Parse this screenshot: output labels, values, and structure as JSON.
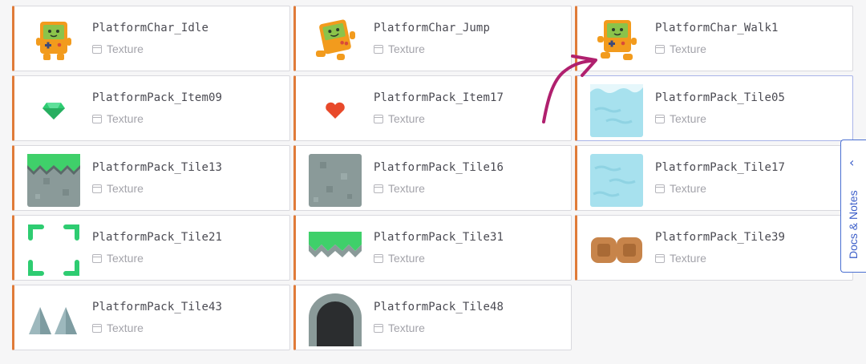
{
  "assets": [
    {
      "name": "PlatformChar_Idle",
      "type": "Texture",
      "thumb": "char-idle"
    },
    {
      "name": "PlatformChar_Jump",
      "type": "Texture",
      "thumb": "char-jump"
    },
    {
      "name": "PlatformChar_Walk1",
      "type": "Texture",
      "thumb": "char-walk"
    },
    {
      "name": "PlatformPack_Item09",
      "type": "Texture",
      "thumb": "gem"
    },
    {
      "name": "PlatformPack_Item17",
      "type": "Texture",
      "thumb": "heart"
    },
    {
      "name": "PlatformPack_Tile05",
      "type": "Texture",
      "thumb": "water-top"
    },
    {
      "name": "PlatformPack_Tile13",
      "type": "Texture",
      "thumb": "grass-stone"
    },
    {
      "name": "PlatformPack_Tile16",
      "type": "Texture",
      "thumb": "stone"
    },
    {
      "name": "PlatformPack_Tile17",
      "type": "Texture",
      "thumb": "water"
    },
    {
      "name": "PlatformPack_Tile21",
      "type": "Texture",
      "thumb": "frame"
    },
    {
      "name": "PlatformPack_Tile31",
      "type": "Texture",
      "thumb": "grass-spikes"
    },
    {
      "name": "PlatformPack_Tile39",
      "type": "Texture",
      "thumb": "wood-blocks"
    },
    {
      "name": "PlatformPack_Tile43",
      "type": "Texture",
      "thumb": "spikes"
    },
    {
      "name": "PlatformPack_Tile48",
      "type": "Texture",
      "thumb": "door"
    }
  ],
  "selected_index": 5,
  "side_tab": {
    "label": "Docs & Notes",
    "icon": "chevron-left-icon"
  },
  "annotation": {
    "icon": "hand-drawn-arrow-icon",
    "color": "#b0206e"
  },
  "colors": {
    "accent_border": "#e07b39",
    "selected_border": "#aab4e8",
    "side_tab": "#3d5fc9"
  }
}
